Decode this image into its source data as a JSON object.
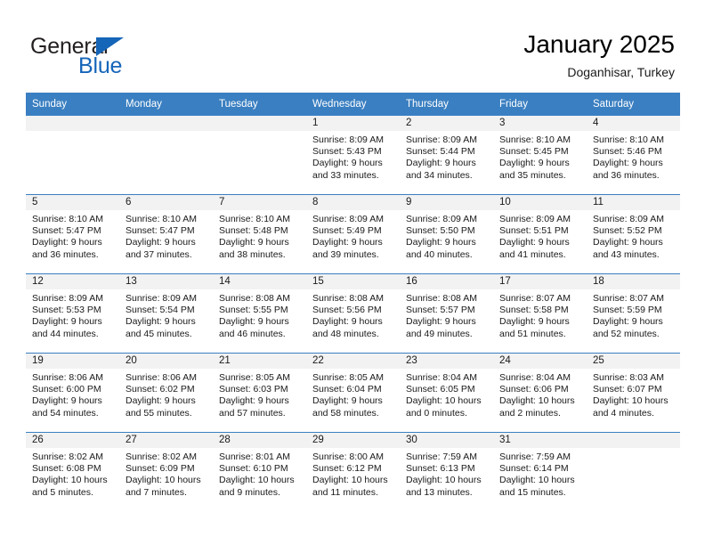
{
  "brand": {
    "line1": "General",
    "line2": "Blue",
    "accent_color": "#1565b8"
  },
  "header": {
    "title": "January 2025",
    "subtitle": "Doganhisar, Turkey"
  },
  "theme": {
    "header_bg": "#3a7fc1",
    "daynum_bg": "#f2f2f2",
    "text": "#1a1a1a"
  },
  "calendar": {
    "weekday_headers": [
      "Sunday",
      "Monday",
      "Tuesday",
      "Wednesday",
      "Thursday",
      "Friday",
      "Saturday"
    ],
    "weeks": [
      [
        {
          "day": "",
          "empty": true
        },
        {
          "day": "",
          "empty": true
        },
        {
          "day": "",
          "empty": true
        },
        {
          "day": "1",
          "sunrise": "Sunrise: 8:09 AM",
          "sunset": "Sunset: 5:43 PM",
          "daylight": "Daylight: 9 hours and 33 minutes."
        },
        {
          "day": "2",
          "sunrise": "Sunrise: 8:09 AM",
          "sunset": "Sunset: 5:44 PM",
          "daylight": "Daylight: 9 hours and 34 minutes."
        },
        {
          "day": "3",
          "sunrise": "Sunrise: 8:10 AM",
          "sunset": "Sunset: 5:45 PM",
          "daylight": "Daylight: 9 hours and 35 minutes."
        },
        {
          "day": "4",
          "sunrise": "Sunrise: 8:10 AM",
          "sunset": "Sunset: 5:46 PM",
          "daylight": "Daylight: 9 hours and 36 minutes."
        }
      ],
      [
        {
          "day": "5",
          "sunrise": "Sunrise: 8:10 AM",
          "sunset": "Sunset: 5:47 PM",
          "daylight": "Daylight: 9 hours and 36 minutes."
        },
        {
          "day": "6",
          "sunrise": "Sunrise: 8:10 AM",
          "sunset": "Sunset: 5:47 PM",
          "daylight": "Daylight: 9 hours and 37 minutes."
        },
        {
          "day": "7",
          "sunrise": "Sunrise: 8:10 AM",
          "sunset": "Sunset: 5:48 PM",
          "daylight": "Daylight: 9 hours and 38 minutes."
        },
        {
          "day": "8",
          "sunrise": "Sunrise: 8:09 AM",
          "sunset": "Sunset: 5:49 PM",
          "daylight": "Daylight: 9 hours and 39 minutes."
        },
        {
          "day": "9",
          "sunrise": "Sunrise: 8:09 AM",
          "sunset": "Sunset: 5:50 PM",
          "daylight": "Daylight: 9 hours and 40 minutes."
        },
        {
          "day": "10",
          "sunrise": "Sunrise: 8:09 AM",
          "sunset": "Sunset: 5:51 PM",
          "daylight": "Daylight: 9 hours and 41 minutes."
        },
        {
          "day": "11",
          "sunrise": "Sunrise: 8:09 AM",
          "sunset": "Sunset: 5:52 PM",
          "daylight": "Daylight: 9 hours and 43 minutes."
        }
      ],
      [
        {
          "day": "12",
          "sunrise": "Sunrise: 8:09 AM",
          "sunset": "Sunset: 5:53 PM",
          "daylight": "Daylight: 9 hours and 44 minutes."
        },
        {
          "day": "13",
          "sunrise": "Sunrise: 8:09 AM",
          "sunset": "Sunset: 5:54 PM",
          "daylight": "Daylight: 9 hours and 45 minutes."
        },
        {
          "day": "14",
          "sunrise": "Sunrise: 8:08 AM",
          "sunset": "Sunset: 5:55 PM",
          "daylight": "Daylight: 9 hours and 46 minutes."
        },
        {
          "day": "15",
          "sunrise": "Sunrise: 8:08 AM",
          "sunset": "Sunset: 5:56 PM",
          "daylight": "Daylight: 9 hours and 48 minutes."
        },
        {
          "day": "16",
          "sunrise": "Sunrise: 8:08 AM",
          "sunset": "Sunset: 5:57 PM",
          "daylight": "Daylight: 9 hours and 49 minutes."
        },
        {
          "day": "17",
          "sunrise": "Sunrise: 8:07 AM",
          "sunset": "Sunset: 5:58 PM",
          "daylight": "Daylight: 9 hours and 51 minutes."
        },
        {
          "day": "18",
          "sunrise": "Sunrise: 8:07 AM",
          "sunset": "Sunset: 5:59 PM",
          "daylight": "Daylight: 9 hours and 52 minutes."
        }
      ],
      [
        {
          "day": "19",
          "sunrise": "Sunrise: 8:06 AM",
          "sunset": "Sunset: 6:00 PM",
          "daylight": "Daylight: 9 hours and 54 minutes."
        },
        {
          "day": "20",
          "sunrise": "Sunrise: 8:06 AM",
          "sunset": "Sunset: 6:02 PM",
          "daylight": "Daylight: 9 hours and 55 minutes."
        },
        {
          "day": "21",
          "sunrise": "Sunrise: 8:05 AM",
          "sunset": "Sunset: 6:03 PM",
          "daylight": "Daylight: 9 hours and 57 minutes."
        },
        {
          "day": "22",
          "sunrise": "Sunrise: 8:05 AM",
          "sunset": "Sunset: 6:04 PM",
          "daylight": "Daylight: 9 hours and 58 minutes."
        },
        {
          "day": "23",
          "sunrise": "Sunrise: 8:04 AM",
          "sunset": "Sunset: 6:05 PM",
          "daylight": "Daylight: 10 hours and 0 minutes."
        },
        {
          "day": "24",
          "sunrise": "Sunrise: 8:04 AM",
          "sunset": "Sunset: 6:06 PM",
          "daylight": "Daylight: 10 hours and 2 minutes."
        },
        {
          "day": "25",
          "sunrise": "Sunrise: 8:03 AM",
          "sunset": "Sunset: 6:07 PM",
          "daylight": "Daylight: 10 hours and 4 minutes."
        }
      ],
      [
        {
          "day": "26",
          "sunrise": "Sunrise: 8:02 AM",
          "sunset": "Sunset: 6:08 PM",
          "daylight": "Daylight: 10 hours and 5 minutes."
        },
        {
          "day": "27",
          "sunrise": "Sunrise: 8:02 AM",
          "sunset": "Sunset: 6:09 PM",
          "daylight": "Daylight: 10 hours and 7 minutes."
        },
        {
          "day": "28",
          "sunrise": "Sunrise: 8:01 AM",
          "sunset": "Sunset: 6:10 PM",
          "daylight": "Daylight: 10 hours and 9 minutes."
        },
        {
          "day": "29",
          "sunrise": "Sunrise: 8:00 AM",
          "sunset": "Sunset: 6:12 PM",
          "daylight": "Daylight: 10 hours and 11 minutes."
        },
        {
          "day": "30",
          "sunrise": "Sunrise: 7:59 AM",
          "sunset": "Sunset: 6:13 PM",
          "daylight": "Daylight: 10 hours and 13 minutes."
        },
        {
          "day": "31",
          "sunrise": "Sunrise: 7:59 AM",
          "sunset": "Sunset: 6:14 PM",
          "daylight": "Daylight: 10 hours and 15 minutes."
        },
        {
          "day": "",
          "empty": true
        }
      ]
    ]
  }
}
